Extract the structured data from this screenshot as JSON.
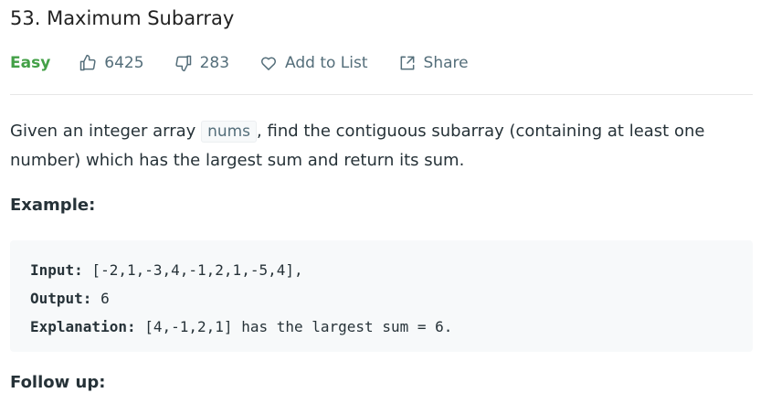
{
  "problem": {
    "title": "53. Maximum Subarray",
    "difficulty": "Easy",
    "likes": "6425",
    "dislikes": "283",
    "add_to_list_label": "Add to List",
    "share_label": "Share"
  },
  "description": {
    "part1": "Given an integer array ",
    "code": "nums",
    "part2": ", find the contiguous subarray (containing at least one number) which has the largest sum and return its sum."
  },
  "example": {
    "heading": "Example:",
    "input_key": "Input:",
    "input_value": " [-2,1,-3,4,-1,2,1,-5,4],",
    "output_key": "Output:",
    "output_value": " 6",
    "explanation_key": "Explanation:",
    "explanation_value": " [4,-1,2,1] has the largest sum = 6."
  },
  "followup": {
    "heading": "Follow up:"
  },
  "icons": {
    "like": "thumbs-up-icon",
    "dislike": "thumbs-down-icon",
    "add_to_list": "heart-icon",
    "share": "share-icon"
  },
  "colors": {
    "difficulty_easy": "#43a047",
    "meta_text": "#546e7a",
    "code_background": "#f7f9fa"
  }
}
